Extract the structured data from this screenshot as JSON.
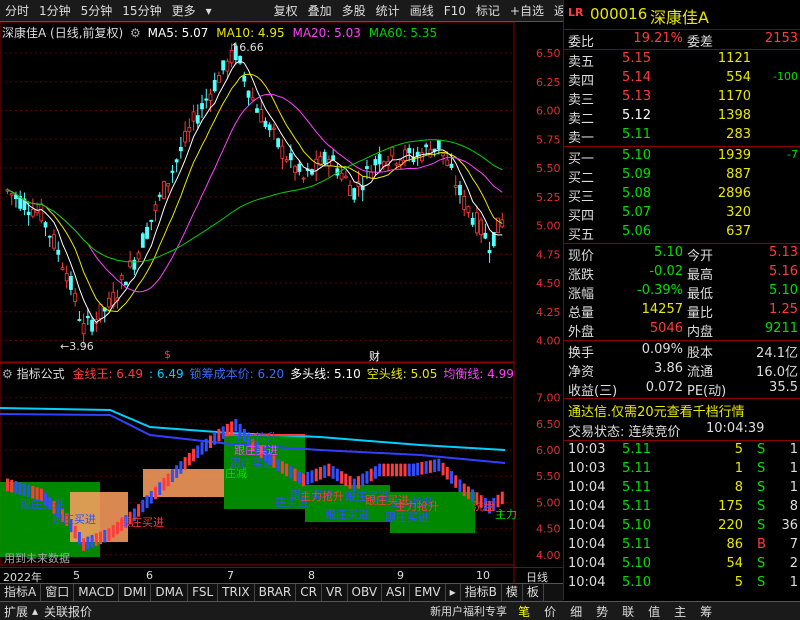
{
  "toolbar": {
    "left": [
      "分时",
      "1分钟",
      "5分钟",
      "15分钟",
      "更多"
    ],
    "right": [
      "复权",
      "叠加",
      "多股",
      "统计",
      "画线",
      "F10",
      "标记",
      "+自选",
      "返回"
    ]
  },
  "stock": {
    "code": "000016",
    "name": "深康佳A",
    "title": "深康佳A (日线,前复权)",
    "logo": "LR"
  },
  "ma": {
    "ma5": "MA5: 5.07",
    "ma10": "MA10: 4.95",
    "ma20": "MA20: 5.03",
    "ma60": "MA60: 5.35"
  },
  "price_axis": [
    "6.50",
    "6.25",
    "6.00",
    "5.75",
    "5.50",
    "5.25",
    "5.00",
    "4.75",
    "4.50",
    "4.25",
    "4.00"
  ],
  "annotations": {
    "high": "6.66",
    "low": "3.96",
    "marker1": "$",
    "marker2": "财"
  },
  "indicator": {
    "name": "指标公式",
    "items": [
      {
        "label": "金线王: 6.49",
        "color": "#ff3b3b"
      },
      {
        "label": ": 6.49",
        "color": "#00d0ff"
      },
      {
        "label": "锁筹成本价: 6.20",
        "color": "#3b6bff"
      },
      {
        "label": "多头线: 5.10",
        "color": "#ffffff"
      },
      {
        "label": "空头线: 5.05",
        "color": "#e8e800"
      },
      {
        "label": "均衡线: 4.99",
        "color": "#ff40ff"
      }
    ]
  },
  "ind_axis": [
    "7.00",
    "6.50",
    "6.00",
    "5.50",
    "5.00",
    "4.50",
    "4.00"
  ],
  "ind_labels": [
    "跟庄买进",
    "主力拉升",
    "跟庄买进",
    "跟庄买进",
    "庄买进",
    "跟庄买进",
    "主力抢升",
    "跟庄买进",
    "跟庄买进",
    "跟庄买进",
    "主力抢升",
    "跟庄买进",
    "洗盘",
    "庄减",
    "主力抢升",
    "跟庄买进",
    "跟庄买进",
    "主力"
  ],
  "note_future": "用到未来数据",
  "time_axis": [
    "2022年",
    "5",
    "6",
    "7",
    "8",
    "9",
    "10"
  ],
  "period": "日线",
  "bottom_tabs": [
    "指标A",
    "窗口",
    "MACD",
    "DMI",
    "DMA",
    "FSL",
    "TRIX",
    "BRAR",
    "CR",
    "VR",
    "OBV",
    "ASI",
    "EMV",
    "指标B",
    "模",
    "板"
  ],
  "status_left": [
    "扩展",
    "关联报价"
  ],
  "status_right": [
    "新用户福利专享",
    "笔",
    "价",
    "细",
    "势",
    "联",
    "值",
    "主",
    "筹"
  ],
  "quote": {
    "weibi_label": "委比",
    "weibi": "19.21%",
    "weicha_label": "委差",
    "weicha": "2153",
    "asks": [
      {
        "label": "卖五",
        "price": "5.15",
        "vol": "1121",
        "chg": ""
      },
      {
        "label": "卖四",
        "price": "5.14",
        "vol": "554",
        "chg": "-100"
      },
      {
        "label": "卖三",
        "price": "5.13",
        "vol": "1170",
        "chg": ""
      },
      {
        "label": "卖二",
        "price": "5.12",
        "vol": "1398",
        "chg": ""
      },
      {
        "label": "卖一",
        "price": "5.11",
        "vol": "283",
        "chg": ""
      }
    ],
    "bids": [
      {
        "label": "买一",
        "price": "5.10",
        "vol": "1939",
        "chg": "-7"
      },
      {
        "label": "买二",
        "price": "5.09",
        "vol": "887",
        "chg": ""
      },
      {
        "label": "买三",
        "price": "5.08",
        "vol": "2896",
        "chg": ""
      },
      {
        "label": "买四",
        "price": "5.07",
        "vol": "320",
        "chg": ""
      },
      {
        "label": "买五",
        "price": "5.06",
        "vol": "637",
        "chg": ""
      }
    ],
    "stats": [
      {
        "l1": "现价",
        "v1": "5.10",
        "c1": "green",
        "l2": "今开",
        "v2": "5.13",
        "c2": "red"
      },
      {
        "l1": "涨跌",
        "v1": "-0.02",
        "c1": "green",
        "l2": "最高",
        "v2": "5.16",
        "c2": "red"
      },
      {
        "l1": "涨幅",
        "v1": "-0.39%",
        "c1": "green",
        "l2": "最低",
        "v2": "5.10",
        "c2": "green"
      },
      {
        "l1": "总量",
        "v1": "14257",
        "c1": "yellow",
        "l2": "量比",
        "v2": "1.25",
        "c2": "red"
      },
      {
        "l1": "外盘",
        "v1": "5046",
        "c1": "red",
        "l2": "内盘",
        "v2": "9211",
        "c2": "green"
      }
    ],
    "stats2": [
      {
        "l1": "换手",
        "v1": "0.09%",
        "l2": "股本",
        "v2": "24.1亿"
      },
      {
        "l1": "净资",
        "v1": "3.86",
        "l2": "流通",
        "v2": "16.0亿"
      },
      {
        "l1": "收益(三)",
        "v1": "0.072",
        "l2": "PE(动)",
        "v2": "35.5"
      }
    ],
    "promo": "通达信.仅需20元查看千档行情",
    "trade_state_label": "交易状态: 连续竞价",
    "trade_time": "10:04:39",
    "ticks": [
      {
        "t": "10:03",
        "p": "5.11",
        "v": "5",
        "s": "S",
        "n": "1"
      },
      {
        "t": "10:03",
        "p": "5.11",
        "v": "1",
        "s": "S",
        "n": "1"
      },
      {
        "t": "10:04",
        "p": "5.11",
        "v": "8",
        "s": "S",
        "n": "1"
      },
      {
        "t": "10:04",
        "p": "5.11",
        "v": "175",
        "s": "S",
        "n": "8"
      },
      {
        "t": "10:04",
        "p": "5.10",
        "v": "220",
        "s": "S",
        "n": "36"
      },
      {
        "t": "10:04",
        "p": "5.11",
        "v": "86",
        "s": "B",
        "n": "7"
      },
      {
        "t": "10:04",
        "p": "5.10",
        "v": "54",
        "s": "S",
        "n": "2"
      },
      {
        "t": "10:04",
        "p": "5.10",
        "v": "5",
        "s": "S",
        "n": "1"
      }
    ]
  }
}
